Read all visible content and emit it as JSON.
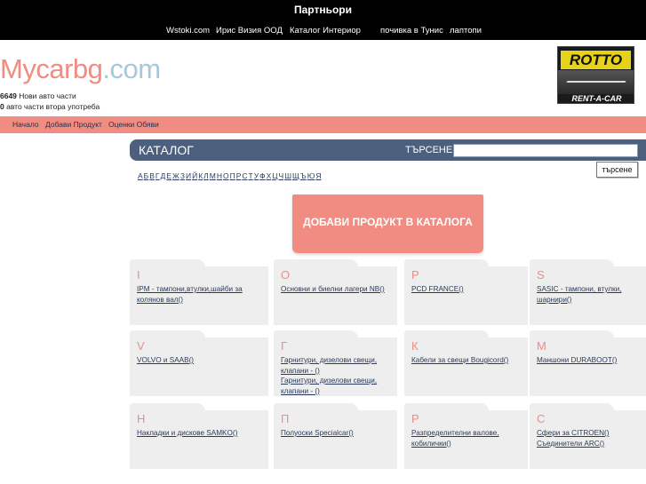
{
  "topbar": {
    "title": "Партньори",
    "links": [
      "Wstoki.com",
      "Ирис Визия ООД",
      "Каталог Интериор",
      "почивка в Тунис",
      "лаптопи"
    ]
  },
  "logo": {
    "part1": "Mycar",
    "part2": "bg",
    "part3": ".com"
  },
  "counts": {
    "new_count": "6649",
    "new_label": "Нови авто части",
    "used_count": "0",
    "used_label": "авто части втора употреба"
  },
  "banner": {
    "name": "ROTTO",
    "sub": "RENT-A-CAR"
  },
  "nav": [
    "Начало",
    "Добави Продукт",
    "Оценки Обяви"
  ],
  "catalog": {
    "title": "КАТАЛОГ",
    "search_label": "ТЪРСЕНЕ",
    "search_value": "",
    "search_button": "търсене",
    "alphabet": [
      "А",
      "Б",
      "В",
      "Г",
      "Д",
      "Е",
      "Ж",
      "З",
      "И",
      "Й",
      "К",
      "Л",
      "М",
      "Н",
      "О",
      "П",
      "Р",
      "С",
      "Т",
      "У",
      "Ф",
      "Х",
      "Ц",
      "Ч",
      "Ш",
      "Щ",
      "Ъ",
      "Ю",
      "Я"
    ],
    "add_button": "ДОБАВИ ПРОДУКТ В КАТАЛОГА"
  },
  "cards": [
    {
      "letter": "I",
      "items": [
        "IPM - тампони,втулки,шайби за колянов вал()"
      ]
    },
    {
      "letter": "O",
      "items": [
        "Основни и биелни лагери NB()"
      ]
    },
    {
      "letter": "P",
      "items": [
        "PCD FRANCE()"
      ]
    },
    {
      "letter": "S",
      "items": [
        "SASIC - тампони, втулки, шарнири()"
      ]
    },
    {
      "letter": "V",
      "items": [
        "VOLVO и SAAB()"
      ]
    },
    {
      "letter": "Г",
      "items": [
        "Гарнитури, дизелови свещи, клапани - ()",
        "Гарнитури, дизелови свещи, клапани - ()"
      ]
    },
    {
      "letter": "К",
      "items": [
        "Кабели за свещи Bougicord()"
      ]
    },
    {
      "letter": "М",
      "items": [
        "Маншони DURABOOT()"
      ]
    },
    {
      "letter": "Н",
      "items": [
        "Накладки и дискове SAMKO()"
      ]
    },
    {
      "letter": "П",
      "items": [
        "Полуоски Specialcar()"
      ]
    },
    {
      "letter": "Р",
      "items": [
        "Разпределителни валове, кобилички()"
      ]
    },
    {
      "letter": "С",
      "items": [
        "Сфери за CITROEN()",
        "Съединители ARC()"
      ]
    }
  ],
  "colors": {
    "accent": "#f08c82",
    "header": "#4c5f7d",
    "logo_blue": "#a8c8d8"
  }
}
